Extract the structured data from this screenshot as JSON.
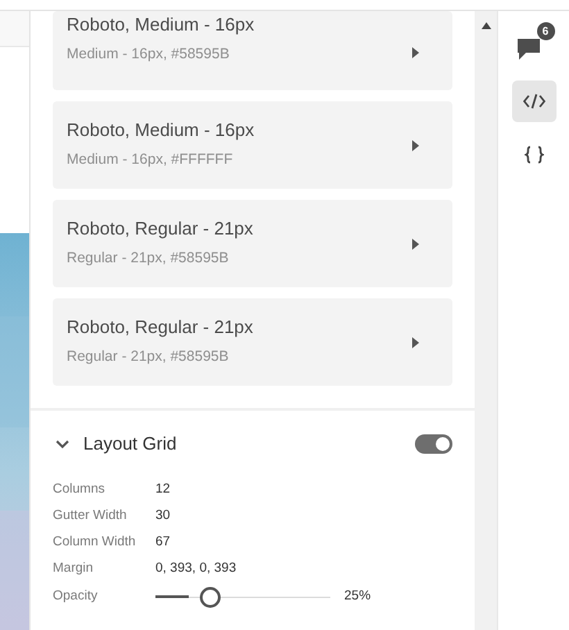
{
  "text_styles": [
    {
      "title": "Roboto, Medium - 16px",
      "detail": "Medium - 16px, #58595B"
    },
    {
      "title": "Roboto, Medium - 16px",
      "detail": "Medium - 16px, #FFFFFF"
    },
    {
      "title": "Roboto, Regular - 21px",
      "detail": "Regular - 21px, #58595B"
    },
    {
      "title": "Roboto, Regular - 21px",
      "detail": "Regular - 21px, #58595B"
    }
  ],
  "layout_grid": {
    "title": "Layout Grid",
    "expanded": true,
    "on": true,
    "properties": [
      {
        "label": "Columns",
        "value": "12"
      },
      {
        "label": "Gutter Width",
        "value": "30"
      },
      {
        "label": "Column Width",
        "value": "67"
      },
      {
        "label": "Margin",
        "value": "0, 393, 0, 393"
      }
    ],
    "opacity": {
      "label": "Opacity",
      "level": 0.25,
      "reading": "25%"
    }
  },
  "rail": {
    "comments_badge": "6",
    "tools": [
      {
        "kind": "code",
        "selected": true
      },
      {
        "kind": "braces",
        "selected": false
      }
    ]
  }
}
